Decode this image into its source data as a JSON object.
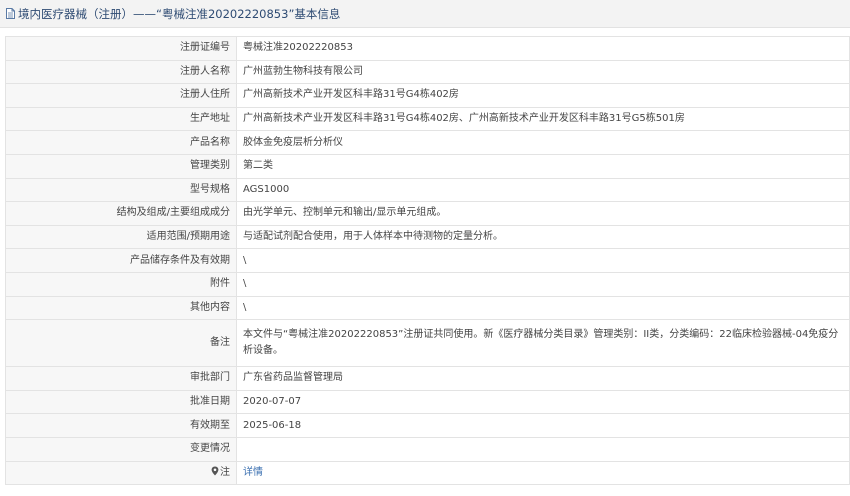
{
  "header": {
    "title": "境内医疗器械（注册）——“粤械注准20202220853”基本信息"
  },
  "rows": [
    {
      "label": "注册证编号",
      "value": "粤械注准20202220853"
    },
    {
      "label": "注册人名称",
      "value": "广州蓝勃生物科技有限公司"
    },
    {
      "label": "注册人住所",
      "value": "广州高新技术产业开发区科丰路31号G4栋402房"
    },
    {
      "label": "生产地址",
      "value": "广州高新技术产业开发区科丰路31号G4栋402房、广州高新技术产业开发区科丰路31号G5栋501房"
    },
    {
      "label": "产品名称",
      "value": "胶体金免疫层析分析仪"
    },
    {
      "label": "管理类别",
      "value": "第二类"
    },
    {
      "label": "型号规格",
      "value": "AGS1000"
    },
    {
      "label": "结构及组成/主要组成成分",
      "value": "由光学单元、控制单元和输出/显示单元组成。"
    },
    {
      "label": "适用范围/预期用途",
      "value": "与适配试剂配合使用，用于人体样本中待测物的定量分析。"
    },
    {
      "label": "产品储存条件及有效期",
      "value": "\\"
    },
    {
      "label": "附件",
      "value": "\\"
    },
    {
      "label": "其他内容",
      "value": "\\"
    },
    {
      "label": "备注",
      "value": "本文件与“粤械注准20202220853”注册证共同使用。新《医疗器械分类目录》管理类别：II类，分类编码：22临床检验器械-04免疫分析设备。"
    },
    {
      "label": "审批部门",
      "value": "广东省药品监督管理局"
    },
    {
      "label": "批准日期",
      "value": "2020-07-07"
    },
    {
      "label": "有效期至",
      "value": "2025-06-18"
    },
    {
      "label": "变更情况",
      "value": ""
    }
  ],
  "note_row": {
    "label": "注",
    "link_text": "详情"
  },
  "icons": {
    "title_icon": "document-icon",
    "note_icon": "pin-icon"
  }
}
